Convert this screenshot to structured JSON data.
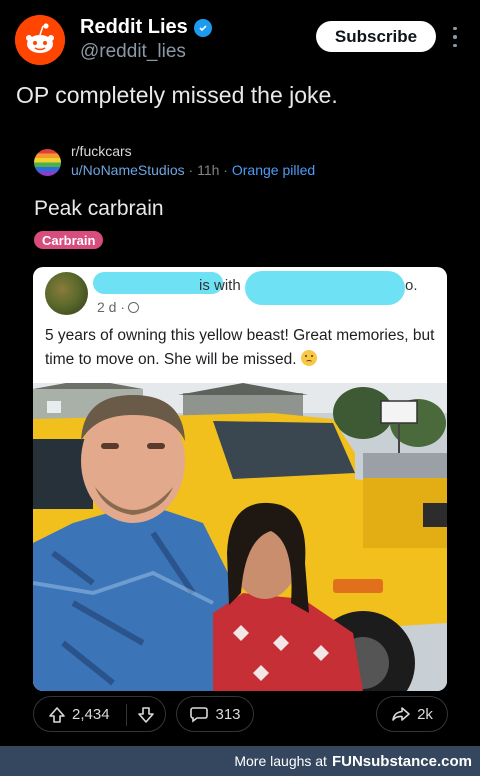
{
  "account": {
    "name": "Reddit Lies",
    "handle": "@reddit_lies",
    "subscribe_label": "Subscribe"
  },
  "tweet": {
    "text": "OP completely missed the joke."
  },
  "reddit_post": {
    "subreddit": "r/fuckcars",
    "user": "u/NoNameStudios",
    "separator": "·",
    "time": "11h",
    "user_flair": "Orange pilled",
    "title": "Peak carbrain",
    "flair": "Carbrain",
    "upvotes": "2,434",
    "comments": "313",
    "shares": "2k"
  },
  "facebook_post": {
    "is_with": "is with",
    "tail": "o.",
    "time": "2 d ·",
    "text": "5 years of owning this yellow beast!  Great memories, but time to move on.  She will be missed."
  },
  "footer": {
    "text": "More laughs at",
    "brand": "FUNsubstance.com"
  },
  "colors": {
    "reddit_orange": "#ff4500",
    "verified_blue": "#1d9bf0",
    "flair_pink": "#d84c7e",
    "redaction_cyan": "#6fe1f4",
    "footer_bg": "#35475f"
  }
}
